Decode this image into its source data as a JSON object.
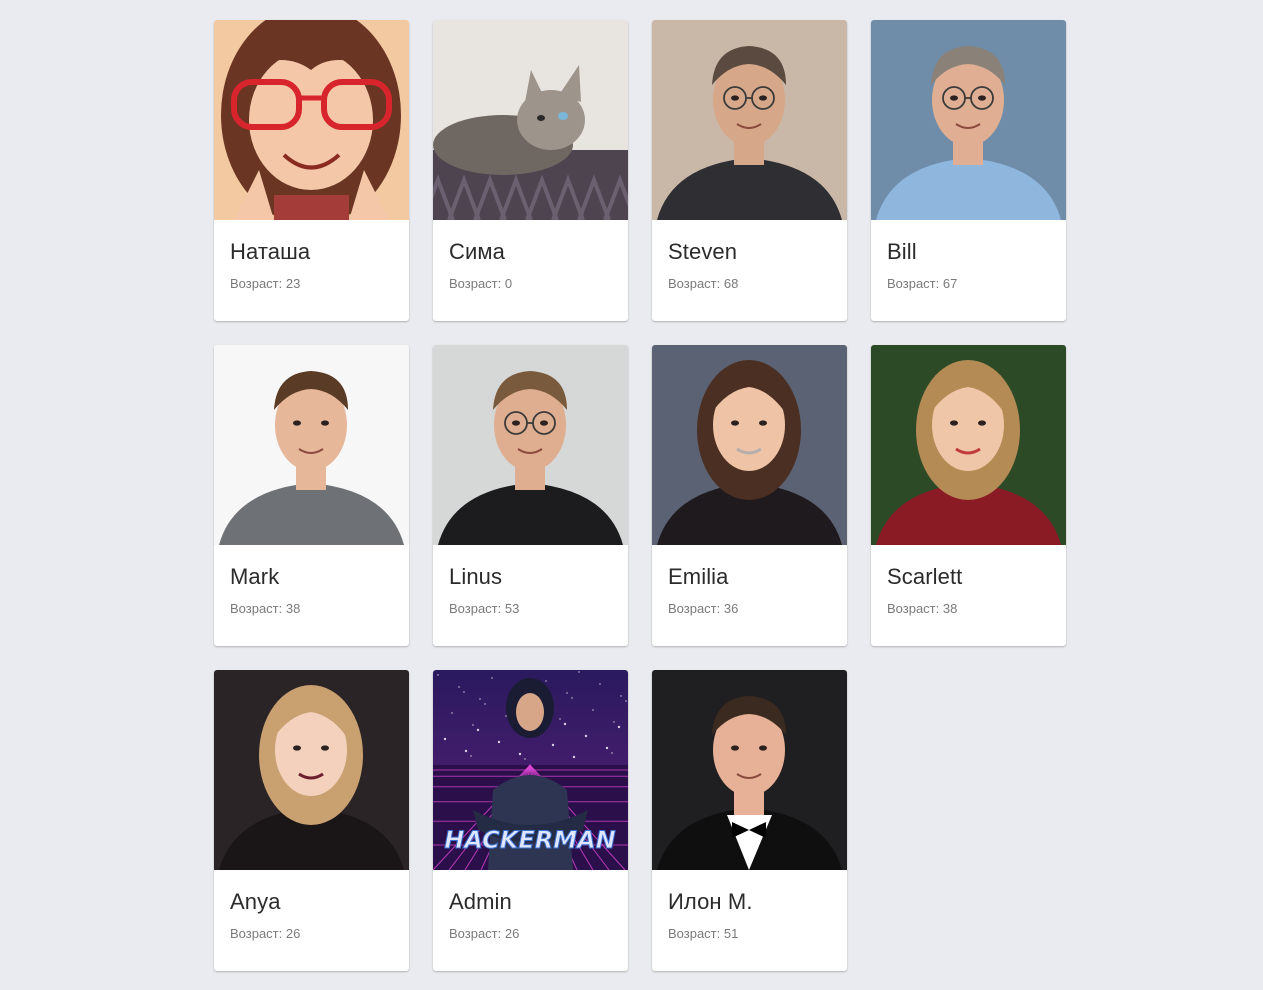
{
  "age_prefix": "Возраст:",
  "cards": [
    {
      "name": "Наташа",
      "age": "23",
      "photo": "cartoon-girl-portrait",
      "palette": {
        "bg": "#f2c9a0",
        "skin": "#f3c7a8",
        "hair": "#6a3523",
        "cloth": "#a43d3a",
        "accent": "#d8242d"
      }
    },
    {
      "name": "Сима",
      "age": "0",
      "photo": "cat-portrait",
      "palette": {
        "bg": "#e8e4e0",
        "skin": "#9d948c",
        "hair": "#6f6761",
        "cloth": "#4d4450",
        "accent": "#7bb7d8"
      }
    },
    {
      "name": "Steven",
      "age": "68",
      "photo": "man-glasses-portrait",
      "palette": {
        "bg": "#c9b8a8",
        "skin": "#d6a889",
        "hair": "#5b4a3f",
        "cloth": "#2e2e33",
        "accent": "#9a8a7a"
      }
    },
    {
      "name": "Bill",
      "age": "67",
      "photo": "man-glasses-portrait",
      "palette": {
        "bg": "#6f8da9",
        "skin": "#e0ae93",
        "hair": "#8a8178",
        "cloth": "#8fb6dd",
        "accent": "#355a7e"
      }
    },
    {
      "name": "Mark",
      "age": "38",
      "photo": "man-portrait",
      "palette": {
        "bg": "#f7f7f7",
        "skin": "#e7b79a",
        "hair": "#5a3b25",
        "cloth": "#6e7175",
        "accent": "#d9d9d9"
      }
    },
    {
      "name": "Linus",
      "age": "53",
      "photo": "man-glasses-portrait",
      "palette": {
        "bg": "#d5d8d6",
        "skin": "#dfad8f",
        "hair": "#7a5a3c",
        "cloth": "#1c1c1e",
        "accent": "#5d7a46"
      }
    },
    {
      "name": "Emilia",
      "age": "36",
      "photo": "woman-portrait",
      "palette": {
        "bg": "#5a6273",
        "skin": "#efc3a6",
        "hair": "#4a2f22",
        "cloth": "#1f1a1e",
        "accent": "#b5b0ae"
      }
    },
    {
      "name": "Scarlett",
      "age": "38",
      "photo": "woman-portrait",
      "palette": {
        "bg": "#2d4a26",
        "skin": "#f0c6a8",
        "hair": "#b58b55",
        "cloth": "#8a1b24",
        "accent": "#c23b3b"
      }
    },
    {
      "name": "Anya",
      "age": "26",
      "photo": "woman-portrait",
      "palette": {
        "bg": "#2a2426",
        "skin": "#f3d1bd",
        "hair": "#c9a070",
        "cloth": "#1a1516",
        "accent": "#6b1f2c"
      }
    },
    {
      "name": "Admin",
      "age": "26",
      "photo": "hackerman-poster",
      "palette": {
        "bg": "#2a1a5e",
        "skin": "#d7a588",
        "hair": "#1a1c33",
        "cloth": "#2d3552",
        "accent": "#e046d5"
      }
    },
    {
      "name": "Илон М.",
      "age": "51",
      "photo": "man-tuxedo-portrait",
      "palette": {
        "bg": "#1f1f21",
        "skin": "#e6b196",
        "hair": "#3b2a20",
        "cloth": "#0f0f10",
        "accent": "#ffffff"
      }
    }
  ],
  "hackerman_text": "HACKERMAN"
}
